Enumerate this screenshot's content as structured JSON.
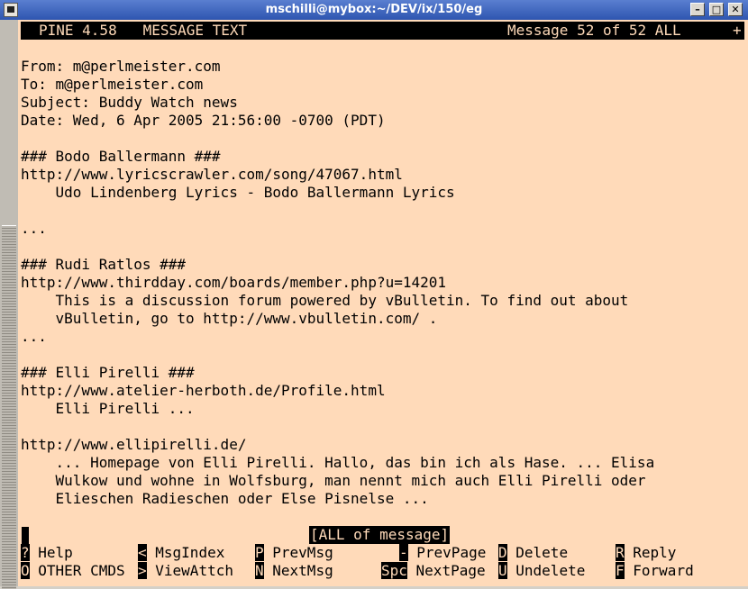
{
  "window": {
    "title": "mschilli@mybox:~/DEV/ix/150/eg",
    "minimize": "–",
    "maximize": "□",
    "close": "✕"
  },
  "pine_header": {
    "left": "PINE 4.58   MESSAGE TEXT",
    "right": "Message 52 of 52 ALL",
    "flag": "+"
  },
  "message": {
    "from": "From: m@perlmeister.com",
    "to": "To: m@perlmeister.com",
    "subject": "Subject: Buddy Watch news",
    "date": "Date: Wed, 6 Apr 2005 21:56:00 -0700 (PDT)",
    "body": [
      "### Bodo Ballermann ###",
      "http://www.lyricscrawler.com/song/47067.html",
      "    Udo Lindenberg Lyrics - Bodo Ballermann Lyrics",
      "...",
      "### Rudi Ratlos ###",
      "http://www.thirdday.com/boards/member.php?u=14201",
      "    This is a discussion forum powered by vBulletin. To find out about",
      "    vBulletin, go to http://www.vbulletin.com/ .",
      "...",
      "### Elli Pirelli ###",
      "http://www.atelier-herboth.de/Profile.html",
      "    Elli Pirelli ...",
      "http://www.ellipirelli.de/",
      "    ... Homepage von Elli Pirelli. Hallo, das bin ich als Hase. ... Elisa",
      "    Wulkow und wohne in Wolfsburg, man nennt mich auch Elli Pirelli oder",
      "    Elieschen Radieschen oder Else Pisnelse ..."
    ]
  },
  "status_line": "[ALL of message]",
  "commands": {
    "help": {
      "key": "?",
      "label": " Help"
    },
    "other": {
      "key": "O",
      "label": " OTHER CMDS"
    },
    "msgindex": {
      "key": "<",
      "label": " MsgIndex"
    },
    "viewattch": {
      "key": ">",
      "label": " ViewAttch"
    },
    "prevmsg": {
      "key": "P",
      "label": " PrevMsg"
    },
    "nextmsg": {
      "key": "N",
      "label": " NextMsg"
    },
    "prevpage": {
      "key": "-",
      "label": " PrevPage"
    },
    "nextpage": {
      "key": "Spc",
      "label": " NextPage"
    },
    "delete": {
      "key": "D",
      "label": " Delete"
    },
    "undelete": {
      "key": "U",
      "label": " Undelete"
    },
    "reply": {
      "key": "R",
      "label": " Reply"
    },
    "forward": {
      "key": "F",
      "label": " Forward"
    }
  },
  "colors": {
    "terminal_bg": "#ffdab9",
    "terminal_fg": "#000000",
    "titlebar": "#2e55b0"
  }
}
